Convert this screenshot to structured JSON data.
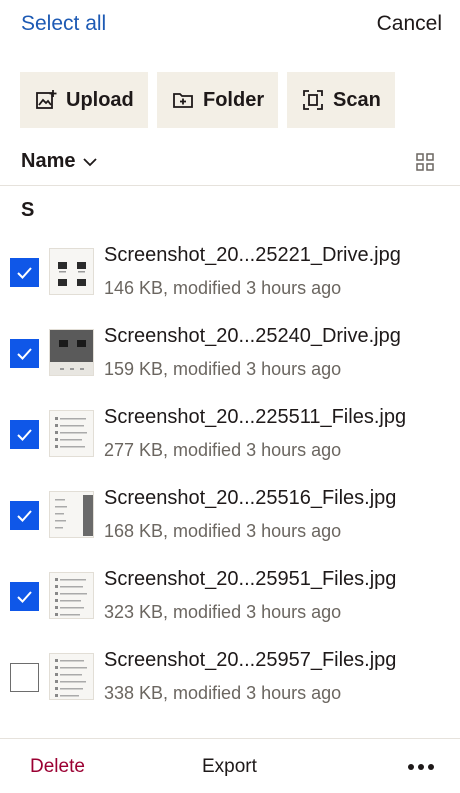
{
  "header": {
    "select_all_label": "Select all",
    "cancel_label": "Cancel"
  },
  "actions": {
    "upload_label": "Upload",
    "folder_label": "Folder",
    "scan_label": "Scan"
  },
  "sort": {
    "label": "Name"
  },
  "section_letter": "S",
  "files": [
    {
      "name": "Screenshot_20...25221_Drive.jpg",
      "meta": "146 KB, modified 3 hours ago",
      "selected": true
    },
    {
      "name": "Screenshot_20...25240_Drive.jpg",
      "meta": "159 KB, modified 3 hours ago",
      "selected": true
    },
    {
      "name": "Screenshot_20...225511_Files.jpg",
      "meta": "277 KB, modified 3 hours ago",
      "selected": true
    },
    {
      "name": "Screenshot_20...25516_Files.jpg",
      "meta": "168 KB, modified 3 hours ago",
      "selected": true
    },
    {
      "name": "Screenshot_20...25951_Files.jpg",
      "meta": "323 KB, modified 3 hours ago",
      "selected": true
    },
    {
      "name": "Screenshot_20...25957_Files.jpg",
      "meta": "338 KB, modified 3 hours ago",
      "selected": false
    }
  ],
  "bottom": {
    "delete_label": "Delete",
    "export_label": "Export"
  },
  "colors": {
    "accent_blue": "#1d5ab4",
    "checkbox_blue": "#0f57e8",
    "delete_red": "#9b0032",
    "action_bg": "#f3efe6"
  }
}
